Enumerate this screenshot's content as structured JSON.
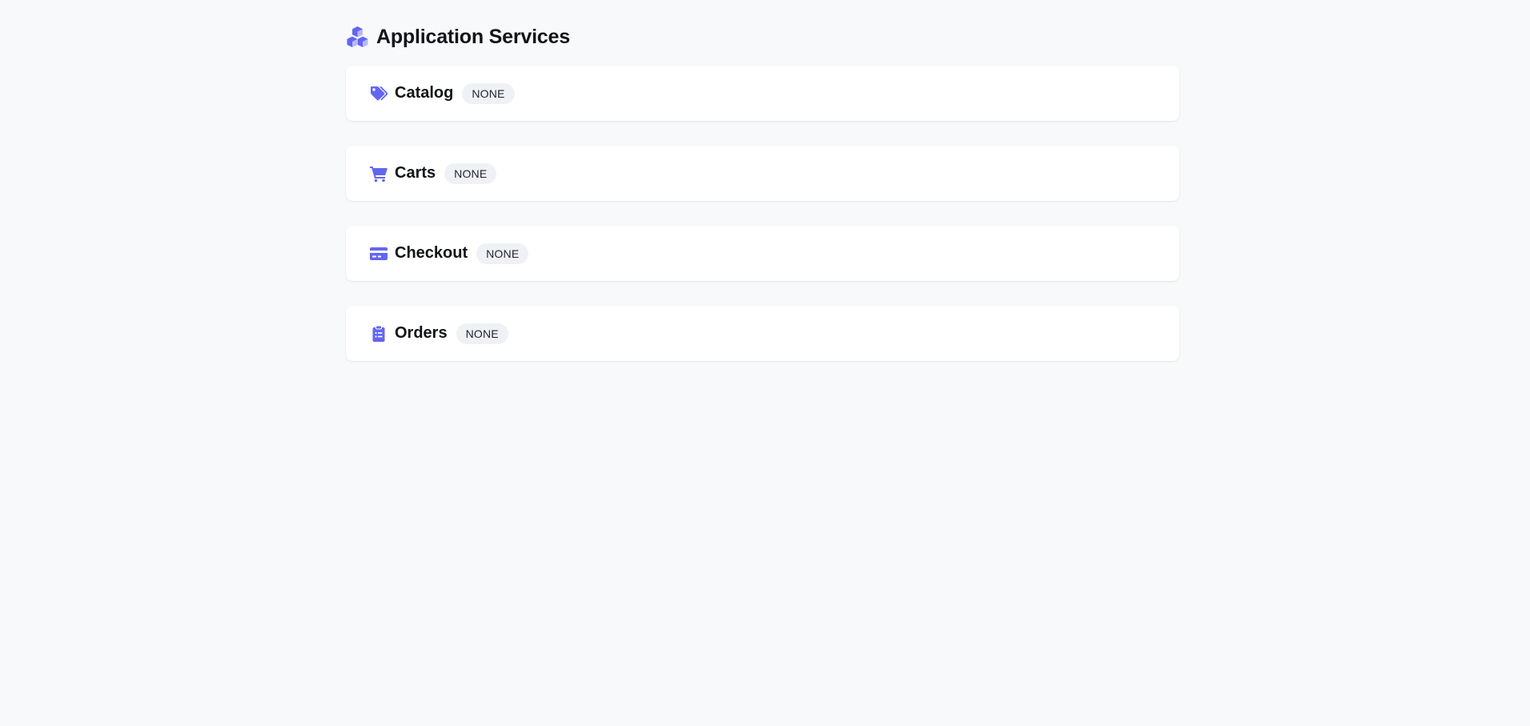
{
  "header": {
    "title": "Application Services",
    "icon": "cubes-icon"
  },
  "colors": {
    "accent": "#6366f1",
    "background": "#f8f9fb",
    "card": "#ffffff",
    "badge_bg": "#eff1f5"
  },
  "services": [
    {
      "name": "Catalog",
      "status": "NONE",
      "icon": "tags-icon"
    },
    {
      "name": "Carts",
      "status": "NONE",
      "icon": "cart-icon"
    },
    {
      "name": "Checkout",
      "status": "NONE",
      "icon": "credit-card-icon"
    },
    {
      "name": "Orders",
      "status": "NONE",
      "icon": "clipboard-list-icon"
    }
  ]
}
